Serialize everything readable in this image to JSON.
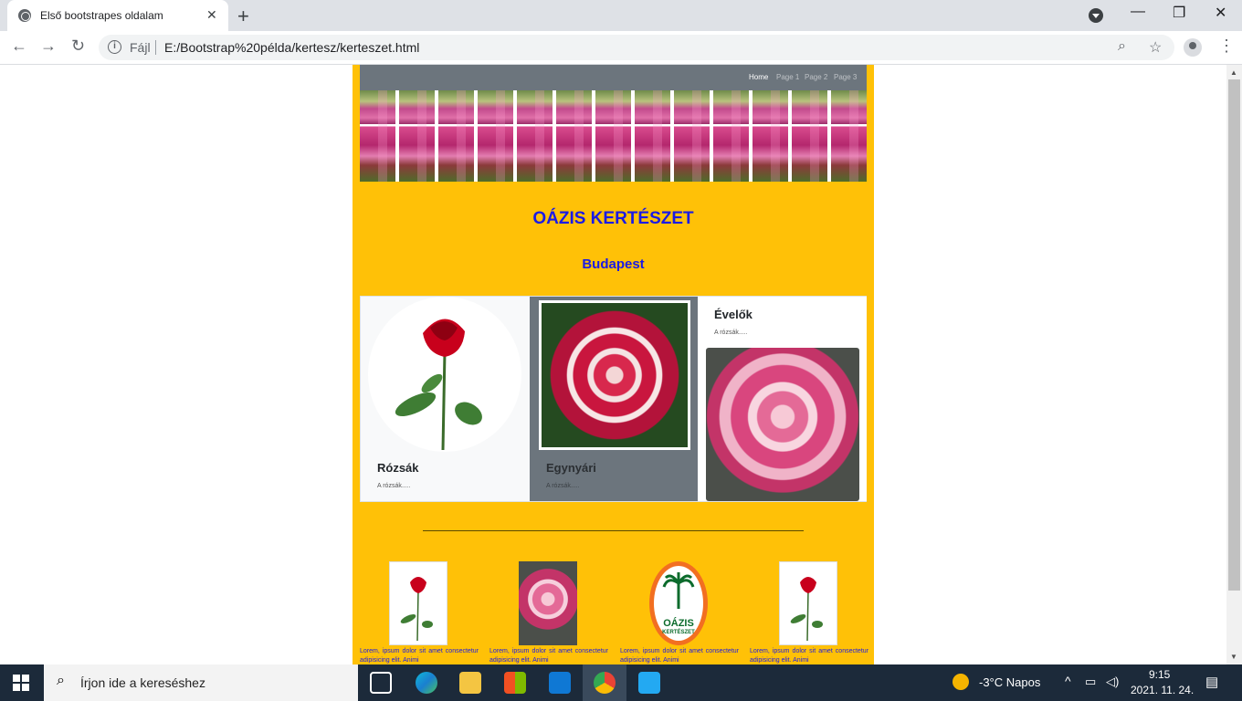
{
  "browser": {
    "tab_title": "Első bootstrapes oldalam",
    "tab_close": "✕",
    "new_tab": "+",
    "scheme": "Fájl",
    "url": "E:/Bootstrap%20példa/kertesz/kerteszet.html",
    "window_controls": [
      "—",
      "❐",
      "✕"
    ]
  },
  "page": {
    "nav": [
      "Home",
      "Page 1",
      "Page 2",
      "Page 3"
    ],
    "title": "OÁZIS KERTÉSZET",
    "subtitle": "Budapest",
    "cards": [
      {
        "title": "Rózsák",
        "text": "A rózsák....."
      },
      {
        "title": "Egynyári",
        "text": "A rózsák....."
      },
      {
        "title": "Évelők",
        "text": "A rózsák....."
      }
    ],
    "logo": {
      "line1": "OÁZIS",
      "line2": "KERTÉSZET"
    },
    "lorem": [
      "Lorem, ipsum dolor sit amet consectetur adipisicing elit. Animi",
      "Lorem, ipsum dolor sit amet consectetur adipisicing elit. Animi",
      "Lorem, ipsum dolor sit amet consectetur adipisicing elit. Animi",
      "Lorem, ipsum dolor sit amet consectetur adipisicing elit. Animi"
    ],
    "colors": {
      "page_bg": "#ffc107",
      "heading": "#1a1ae6",
      "navbar": "#6c757d"
    }
  },
  "taskbar": {
    "search_placeholder": "Írjon ide a kereséshez",
    "weather": "-3°C  Napos",
    "time": "9:15",
    "date": "2021. 11. 24."
  }
}
